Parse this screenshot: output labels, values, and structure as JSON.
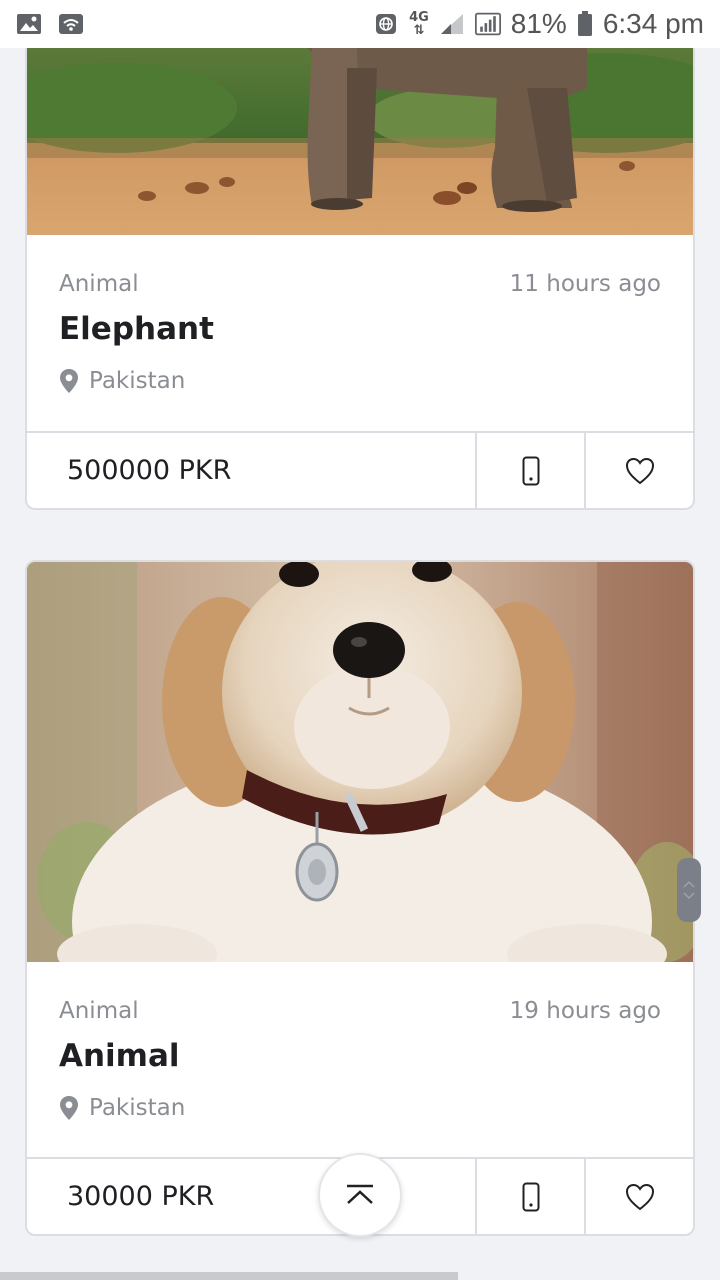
{
  "status_bar": {
    "network": "4G",
    "battery": "81%",
    "time": "6:34 pm",
    "icons": [
      "image-icon",
      "wifi-icon",
      "vpn-icon",
      "signal-icon",
      "signal-full-icon",
      "battery-icon"
    ]
  },
  "listings": [
    {
      "category": "Animal",
      "time_ago": "11 hours ago",
      "title": "Elephant",
      "location": "Pakistan",
      "price": "500000 PKR",
      "image": "elephant-photo"
    },
    {
      "category": "Animal",
      "time_ago": "19 hours ago",
      "title": "Animal",
      "location": "Pakistan",
      "price": "30000 PKR",
      "image": "puppy-photo"
    }
  ],
  "colors": {
    "background": "#f1f2f6",
    "card": "#ffffff",
    "border": "#dcdde2",
    "muted_text": "#8a8d93",
    "text": "#1f2023"
  }
}
